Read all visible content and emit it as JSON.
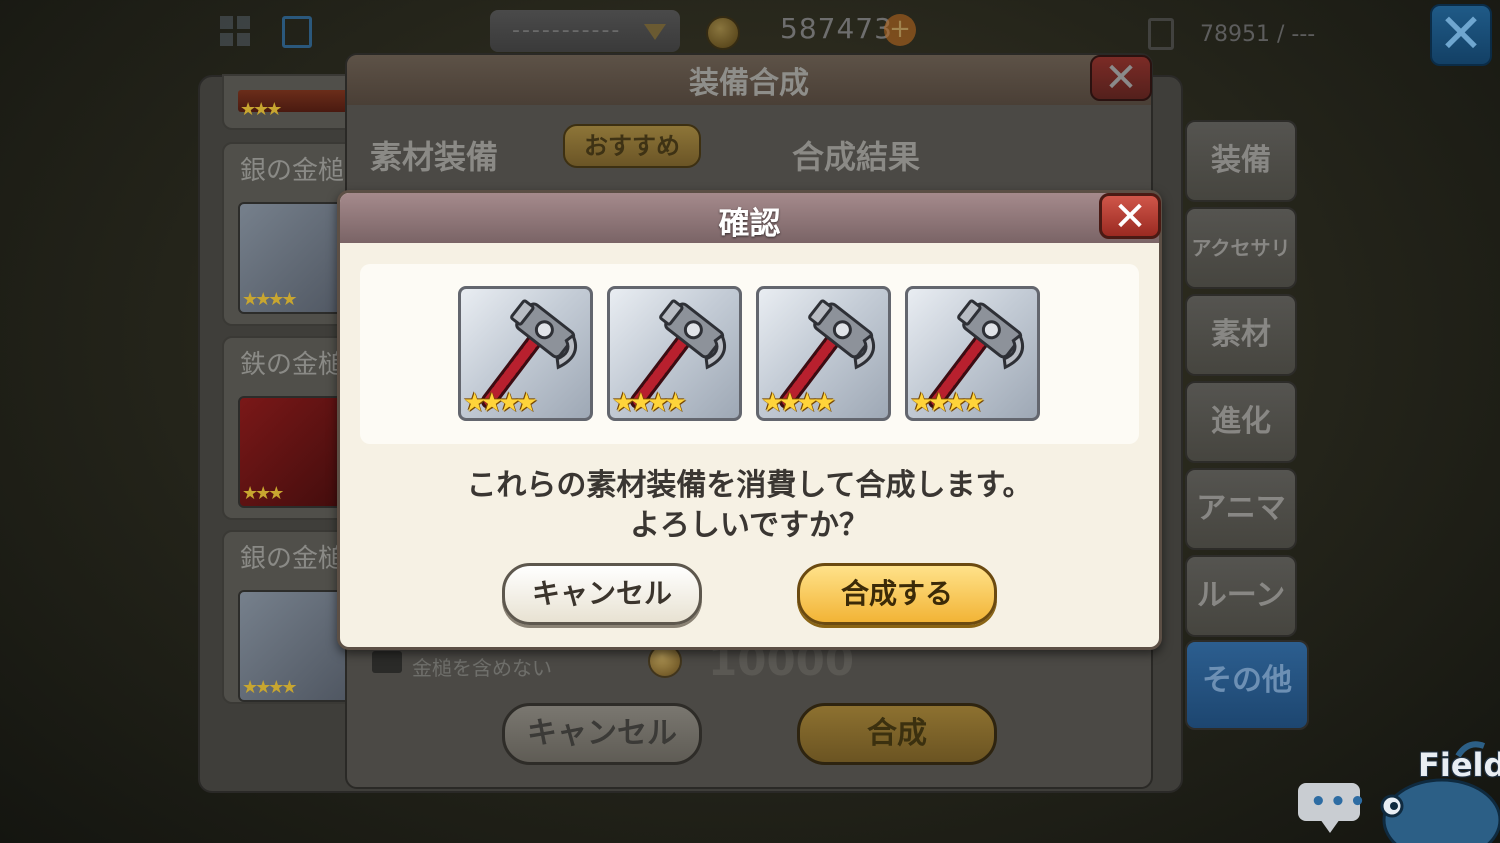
{
  "hud": {
    "dropdown_value": "-----------",
    "gold": "587473",
    "plus": "+",
    "inventory_count": "78951 / ---",
    "close": "✕"
  },
  "list": {
    "items": [
      {
        "name": "銀の金槌",
        "stars": "★★★★"
      },
      {
        "name": "鉄の金槌",
        "stars": "★★★"
      },
      {
        "name": "銀の金槌",
        "stars": "★★★★"
      }
    ],
    "first_stars": "★★★"
  },
  "tabs": [
    "装備",
    "アクセサリ",
    "素材",
    "進化",
    "アニマ",
    "ルーン",
    "その他"
  ],
  "synthesis": {
    "title": "装備合成",
    "material_label": "素材装備",
    "recommend_button": "おすすめ",
    "result_label": "合成結果",
    "exclude_hammer_label": "金槌を含めない",
    "cost": "10000",
    "cancel_button": "キャンセル",
    "synth_button": "合成"
  },
  "confirm": {
    "title": "確認",
    "close": "✕",
    "items": [
      {
        "icon": "silver-hammer-icon",
        "stars": "★★★★"
      },
      {
        "icon": "silver-hammer-icon",
        "stars": "★★★★"
      },
      {
        "icon": "silver-hammer-icon",
        "stars": "★★★★"
      },
      {
        "icon": "silver-hammer-icon",
        "stars": "★★★★"
      }
    ],
    "message_line1": "これらの素材装備を消費して合成します。",
    "message_line2": "よろしいですか？",
    "cancel_button": "キャンセル",
    "ok_button": "合成する"
  },
  "corner": {
    "chat": "•••",
    "field": "Field"
  },
  "colors": {
    "dialog_header": "#a58a8c",
    "ok_button": "#f2b436",
    "active_tab": "#2c5e8f"
  }
}
